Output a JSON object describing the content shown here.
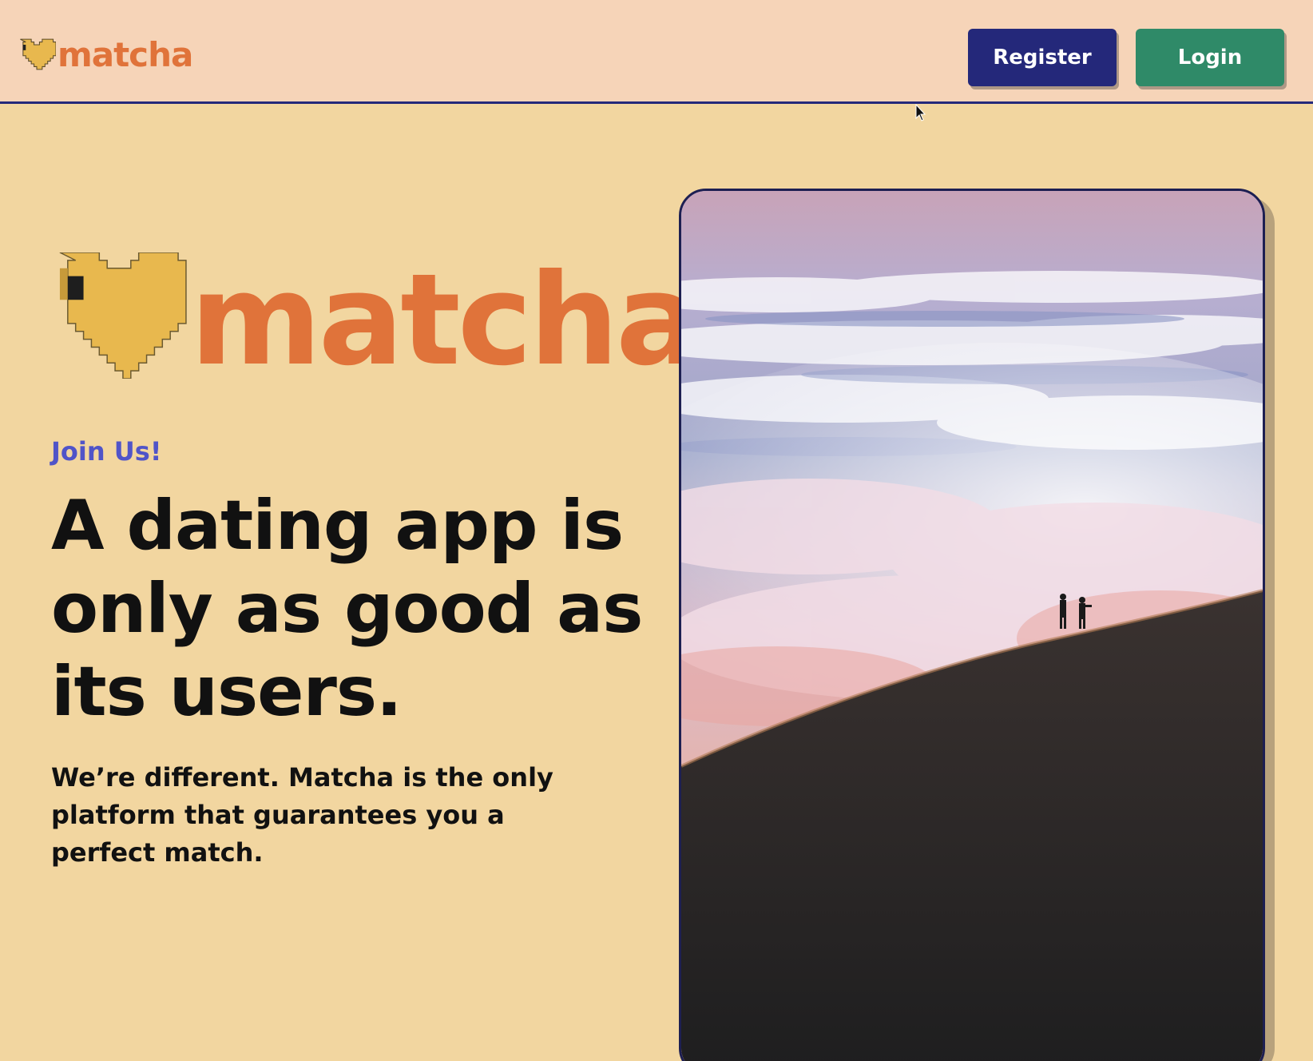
{
  "header": {
    "brand": "matcha",
    "register_label": "Register",
    "login_label": "Login"
  },
  "hero": {
    "logo_text": "matcha",
    "eyebrow": "Join Us!",
    "headline": "A dating app is only as good as its users.",
    "subtext": "We’re different. Matcha is the only platform that guarantees you a perfect match."
  },
  "icons": {
    "logo_icon": "pixel-heart-icon",
    "cursor": "mouse-pointer-icon"
  },
  "colors": {
    "page_bg": "#f2d6a0",
    "header_bg": "#f6d4b8",
    "brand_orange": "#e0733a",
    "heart_yellow": "#e8b84e",
    "register_bg": "#24287a",
    "login_bg": "#2f8a68",
    "eyebrow": "#5054c8"
  }
}
